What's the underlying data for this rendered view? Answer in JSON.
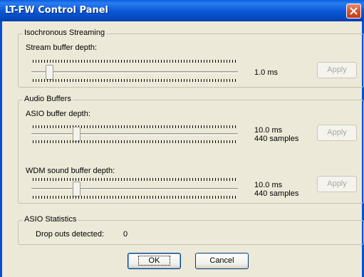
{
  "window": {
    "title": "LT-FW Control Panel",
    "close_icon": "close-icon"
  },
  "isochronous": {
    "group_title": "Isochronous Streaming",
    "stream_label": "Stream buffer depth:",
    "stream_value": "1.0 ms",
    "apply_label": "Apply"
  },
  "audio": {
    "group_title": "Audio Buffers",
    "asio_label": "ASIO buffer depth:",
    "asio_value_ms": "10.0 ms",
    "asio_value_samples": "440 samples",
    "asio_apply_label": "Apply",
    "wdm_label": "WDM sound buffer depth:",
    "wdm_value_ms": "10.0 ms",
    "wdm_value_samples": "440 samples",
    "wdm_apply_label": "Apply"
  },
  "stats": {
    "group_title": "ASIO Statistics",
    "dropouts_label": "Drop outs detected:",
    "dropouts_value": "0"
  },
  "buttons": {
    "ok_label": "OK",
    "cancel_label": "Cancel"
  }
}
